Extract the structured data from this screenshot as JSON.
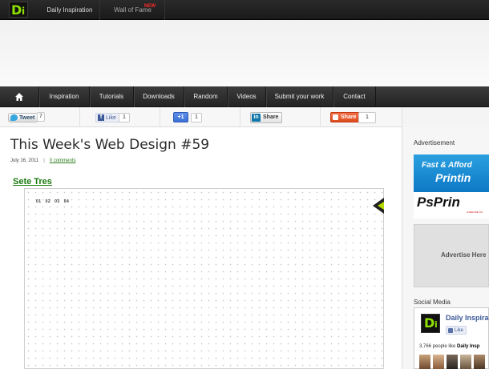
{
  "topbar": {
    "logo": {
      "d": "D",
      "i": "i"
    },
    "nav": [
      {
        "label": "Daily Inspiration"
      },
      {
        "label": "Wall of Fame"
      }
    ],
    "new_badge": "NEW"
  },
  "mainnav": {
    "items": [
      "Inspiration",
      "Tutorials",
      "Downloads",
      "Random",
      "Videos",
      "Submit your work",
      "Contact"
    ]
  },
  "share": {
    "tweet_label": "Tweet",
    "tweet_count": "7",
    "fb_label": "Like",
    "fb_count": "1",
    "gplus_label": "+1",
    "gplus_count": "1",
    "linkedin_label": "Share",
    "share_label": "Share",
    "share_count": "1"
  },
  "post": {
    "title": "This Week's Web Design #59",
    "date": "July 16, 2011",
    "separator": "|",
    "comments": "0 comments",
    "subheading": "Sete Tres",
    "screenshot_nums": [
      "01",
      "02",
      "03",
      "04"
    ]
  },
  "sidebar": {
    "ad_heading": "Advertisement",
    "ad_banner_line1": "Fast & Afford",
    "ad_banner_line2": "Printin",
    "ad_banner_brand": "PsPrin",
    "ad_banner_small": "A DELUXE CO",
    "advertise_text": "Advertise Here",
    "social_heading": "Social Media",
    "fb_page_name": "Daily Inspira",
    "fb_like_label": "Like",
    "fb_count_prefix": "3,766 people like ",
    "fb_count_name": "Daily Insp"
  },
  "colors": {
    "accent_green": "#8ee000",
    "link_green": "#1b7a10",
    "facebook_blue": "#3b5998",
    "twitter_blue": "#37a7e0",
    "linkedin_blue": "#0e76a8",
    "share_orange": "#de4b1d",
    "new_badge_red": "#ff2a2a"
  },
  "icons": [
    "logo-icon",
    "home-icon",
    "twitter-bird-icon",
    "facebook-f-icon",
    "linkedin-icon",
    "share-icon"
  ]
}
